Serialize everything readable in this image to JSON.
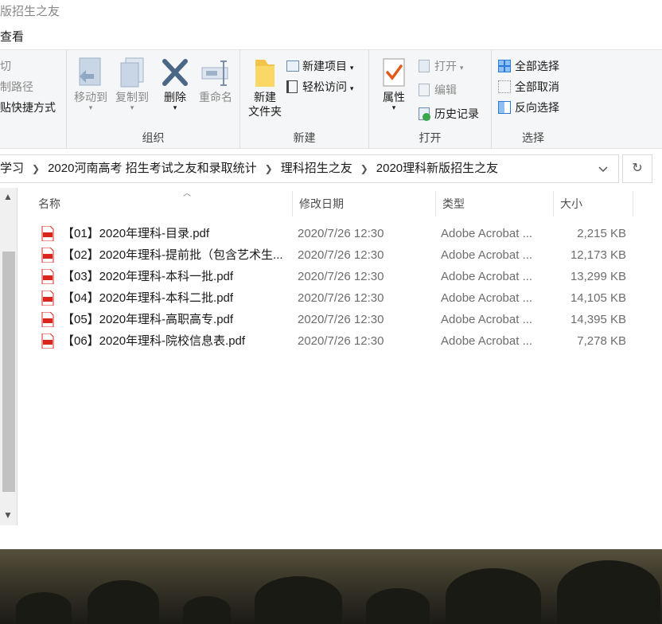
{
  "window": {
    "title": "版招生之友",
    "menu": {
      "view": "查看"
    }
  },
  "ribbon": {
    "clipboard": {
      "cut": "切",
      "copy_path": "制路径",
      "paste_shortcut": "贴快捷方式"
    },
    "organize": {
      "label": "组织",
      "move_to": "移动到",
      "copy_to": "复制到",
      "delete": "删除",
      "rename": "重命名"
    },
    "new": {
      "label": "新建",
      "new_folder_line1": "新建",
      "new_folder_line2": "文件夹",
      "new_item": "新建项目",
      "easy_access": "轻松访问"
    },
    "open": {
      "label": "打开",
      "properties": "属性",
      "open": "打开",
      "edit": "编辑",
      "history": "历史记录"
    },
    "select": {
      "label": "选择",
      "select_all": "全部选择",
      "select_none": "全部取消",
      "invert": "反向选择"
    }
  },
  "address": {
    "crumbs": [
      "学习",
      "2020河南高考 招生考试之友和录取统计",
      "理科招生之友",
      "2020理科新版招生之友"
    ]
  },
  "columns": {
    "name": "名称",
    "date": "修改日期",
    "type": "类型",
    "size": "大小"
  },
  "files": [
    {
      "name": "【01】2020年理科-目录.pdf",
      "date": "2020/7/26 12:30",
      "type": "Adobe Acrobat ...",
      "size": "2,215 KB"
    },
    {
      "name": "【02】2020年理科-提前批（包含艺术生...",
      "date": "2020/7/26 12:30",
      "type": "Adobe Acrobat ...",
      "size": "12,173 KB"
    },
    {
      "name": "【03】2020年理科-本科一批.pdf",
      "date": "2020/7/26 12:30",
      "type": "Adobe Acrobat ...",
      "size": "13,299 KB"
    },
    {
      "name": "【04】2020年理科-本科二批.pdf",
      "date": "2020/7/26 12:30",
      "type": "Adobe Acrobat ...",
      "size": "14,105 KB"
    },
    {
      "name": "【05】2020年理科-高职高专.pdf",
      "date": "2020/7/26 12:30",
      "type": "Adobe Acrobat ...",
      "size": "14,395 KB"
    },
    {
      "name": "【06】2020年理科-院校信息表.pdf",
      "date": "2020/7/26 12:30",
      "type": "Adobe Acrobat ...",
      "size": "7,278 KB"
    }
  ],
  "colors": {
    "pdf_red": "#d9261c",
    "accent_blue": "#2b79d8",
    "folder_yellow": "#f3c44a"
  }
}
